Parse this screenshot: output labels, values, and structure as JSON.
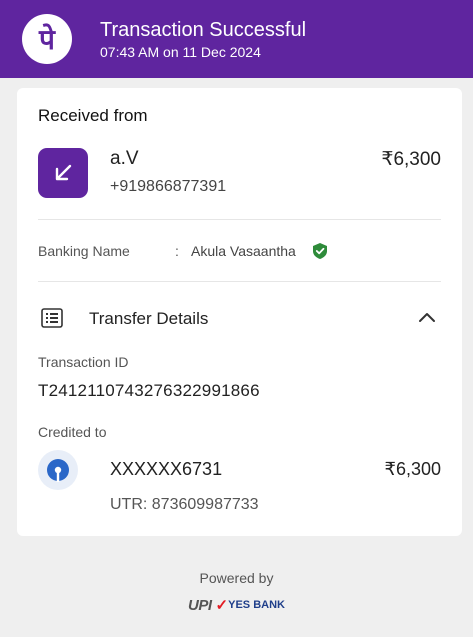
{
  "header": {
    "logo_text": "पे",
    "title": "Transaction Successful",
    "subtitle": "07:43 AM on 11 Dec 2024"
  },
  "received": {
    "section_title": "Received from",
    "sender_name": "a.V",
    "sender_phone": "+919866877391",
    "amount": "₹6,300",
    "banking_name_label": "Banking Name",
    "banking_name_separator": ":",
    "banking_name_value": "Akula Vasaantha"
  },
  "transfer": {
    "title": "Transfer Details",
    "transaction_id_label": "Transaction ID",
    "transaction_id": "T2412110743276322991866",
    "credited_to_label": "Credited to",
    "account": "XXXXXX6731",
    "amount": "₹6,300",
    "utr": "UTR: 873609987733"
  },
  "footer": {
    "powered_by": "Powered by",
    "upi_text": "UPI",
    "bank_text": "YES BANK"
  },
  "colors": {
    "brand_purple": "#5f259f",
    "verified_green": "#2e8b3a",
    "sbi_blue": "#2a67c8"
  },
  "icons": {
    "brand": "phonepe-logo-icon",
    "received": "arrow-down-left-icon",
    "verified": "shield-check-icon",
    "details": "list-icon",
    "collapse": "chevron-up-icon",
    "bank": "sbi-logo-icon"
  }
}
